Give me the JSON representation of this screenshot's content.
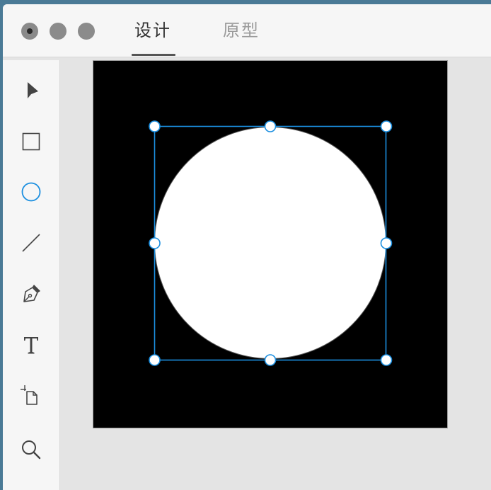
{
  "window": {
    "traffic_lights": [
      "close",
      "minimize",
      "maximize"
    ]
  },
  "tabs": [
    {
      "label": "设计",
      "active": true
    },
    {
      "label": "原型",
      "active": false
    }
  ],
  "toolbar": {
    "tools": [
      {
        "name": "select",
        "icon": "arrow-pointer-icon",
        "active": false
      },
      {
        "name": "rectangle",
        "icon": "rectangle-icon",
        "active": false
      },
      {
        "name": "ellipse",
        "icon": "ellipse-icon",
        "active": true
      },
      {
        "name": "line",
        "icon": "line-icon",
        "active": false
      },
      {
        "name": "pen",
        "icon": "pen-icon",
        "active": false
      },
      {
        "name": "text",
        "icon": "text-icon",
        "active": false
      },
      {
        "name": "artboard",
        "icon": "artboard-icon",
        "active": false
      },
      {
        "name": "zoom",
        "icon": "magnifier-icon",
        "active": false
      }
    ]
  },
  "canvas": {
    "artboard_color": "#000000",
    "shape": {
      "type": "ellipse",
      "fill": "#ffffff",
      "stroke": "#555555",
      "selected": true
    },
    "selection_color": "#1b8fe0"
  },
  "colors": {
    "accent": "#1b8fe0",
    "tool_icon": "#444444"
  }
}
